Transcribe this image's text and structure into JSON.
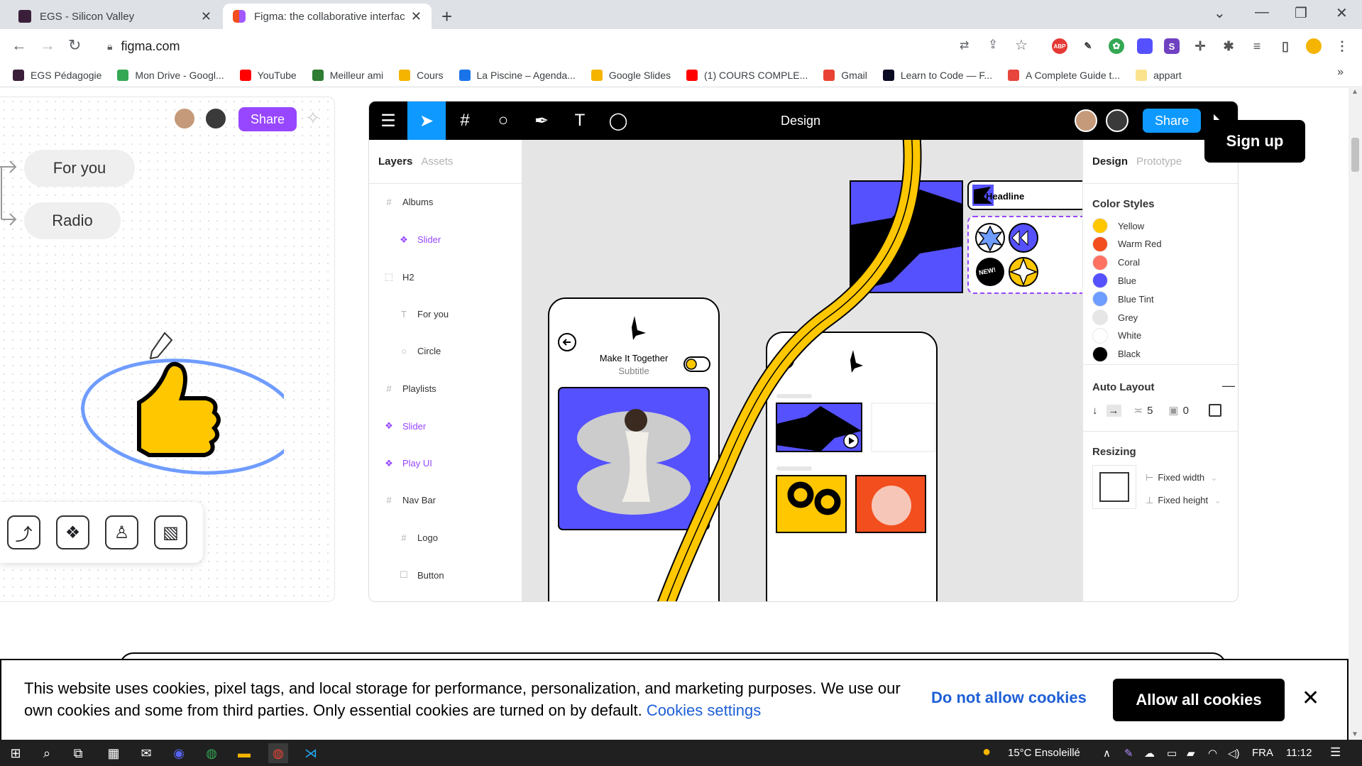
{
  "browser": {
    "tabs": [
      {
        "title": "EGS - Silicon Valley",
        "active": false
      },
      {
        "title": "Figma: the collaborative interface",
        "active": true
      }
    ],
    "url": "figma.com",
    "bookmarks": [
      {
        "label": "EGS Pédagogie",
        "color": "#3b1f3a"
      },
      {
        "label": "Mon Drive - Googl...",
        "color": "#34a853"
      },
      {
        "label": "YouTube",
        "color": "#ff0000"
      },
      {
        "label": "Meilleur ami",
        "color": "#2e7d32"
      },
      {
        "label": "Cours",
        "color": "#f4b400"
      },
      {
        "label": "La Piscine – Agenda...",
        "color": "#1a73e8"
      },
      {
        "label": "Google Slides",
        "color": "#f4b400"
      },
      {
        "label": "(1) COURS COMPLE...",
        "color": "#ff0000"
      },
      {
        "label": "Gmail",
        "color": "#ea4335"
      },
      {
        "label": "Learn to Code — F...",
        "color": "#0a0a23"
      },
      {
        "label": "A Complete Guide t...",
        "color": "#e8453c"
      },
      {
        "label": "appart",
        "color": "#fbe38e"
      }
    ]
  },
  "left_card": {
    "share_label": "Share",
    "pills": [
      "For you",
      "Radio"
    ]
  },
  "figma": {
    "toolbar_title": "Design",
    "share_label": "Share",
    "layers_tab": "Layers",
    "assets_tab": "Assets",
    "layers": [
      {
        "label": "Albums",
        "icon": "#",
        "indent": 0,
        "purple": false
      },
      {
        "label": "Slider",
        "icon": "❖",
        "indent": 1,
        "purple": true
      },
      {
        "label": "H2",
        "icon": "⬚",
        "indent": 0,
        "purple": false
      },
      {
        "label": "For you",
        "icon": "T",
        "indent": 1,
        "purple": false
      },
      {
        "label": "Circle",
        "icon": "○",
        "indent": 1,
        "purple": false
      },
      {
        "label": "Playlists",
        "icon": "#",
        "indent": 0,
        "purple": false
      },
      {
        "label": "Slider",
        "icon": "❖",
        "indent": 0,
        "purple": true
      },
      {
        "label": "Play UI",
        "icon": "❖",
        "indent": 0,
        "purple": true
      },
      {
        "label": "Nav Bar",
        "icon": "#",
        "indent": 0,
        "purple": false
      },
      {
        "label": "Logo",
        "icon": "#",
        "indent": 1,
        "purple": false
      },
      {
        "label": "Button",
        "icon": "☐",
        "indent": 1,
        "purple": false
      }
    ],
    "design_tab": "Design",
    "prototype_tab": "Prototype",
    "color_styles_title": "Color Styles",
    "color_styles": [
      {
        "name": "Yellow",
        "hex": "#ffc700"
      },
      {
        "name": "Warm Red",
        "hex": "#f24e1e"
      },
      {
        "name": "Coral",
        "hex": "#ff7262"
      },
      {
        "name": "Blue",
        "hex": "#5551ff"
      },
      {
        "name": "Blue Tint",
        "hex": "#6f9cff"
      },
      {
        "name": "Grey",
        "hex": "#e6e6e6"
      },
      {
        "name": "White",
        "hex": "#ffffff"
      },
      {
        "name": "Black",
        "hex": "#000000"
      }
    ],
    "auto_layout_title": "Auto Layout",
    "auto_layout_spacing": "5",
    "auto_layout_padding": "0",
    "resizing_title": "Resizing",
    "fixed_width": "Fixed width",
    "fixed_height": "Fixed height",
    "canvas": {
      "headline": "Headline",
      "new_badge": "NEW!",
      "make_it_together": "Make It Together",
      "subtitle": "Subtitle"
    }
  },
  "signup_label": "Sign up",
  "cookie": {
    "text": "This website uses cookies, pixel tags, and local storage for performance, personalization, and marketing purposes. We use our own cookies and some from third parties. Only essential cookies are turned on by default.",
    "settings_link": "Cookies settings",
    "deny_label": "Do not allow cookies",
    "allow_label": "Allow all cookies"
  },
  "taskbar": {
    "weather": "15°C Ensoleillé",
    "lang": "FRA",
    "time": "11:12"
  }
}
